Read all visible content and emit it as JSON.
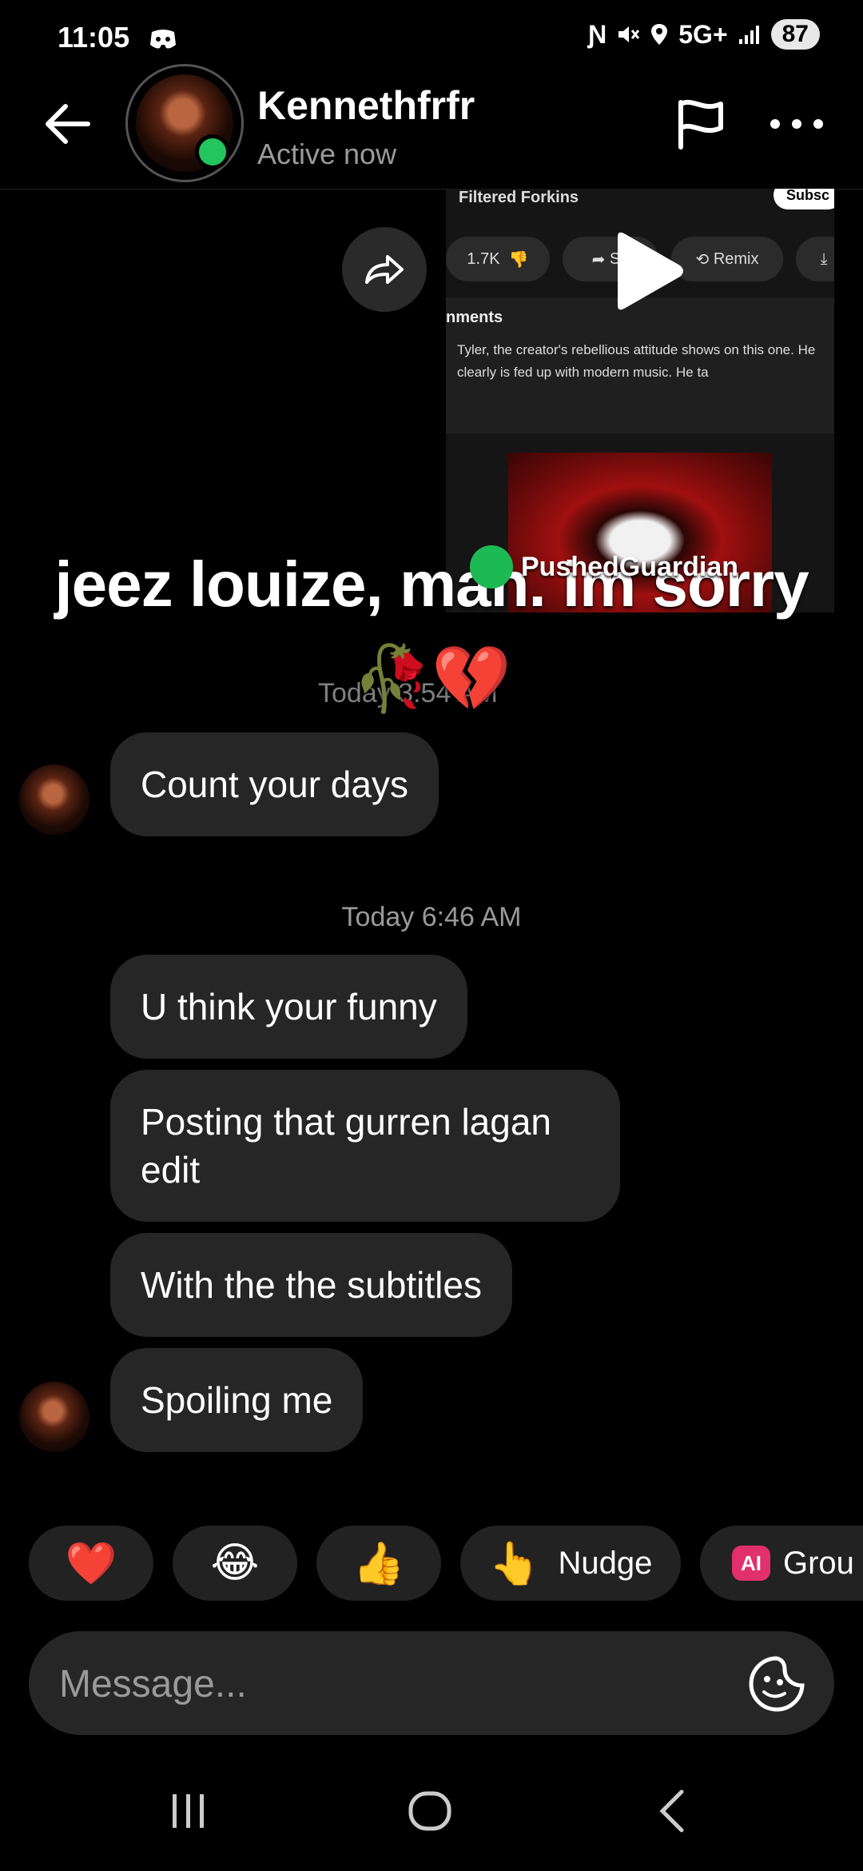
{
  "status_bar": {
    "time": "11:05",
    "network": "5G+",
    "battery": "87"
  },
  "header": {
    "name": "Kennethfrfr",
    "status": "Active now"
  },
  "shared_post": {
    "title": "Filtered Forkins",
    "subscribe": "Subsc",
    "likes": "1.7K",
    "share_label": "Sh",
    "remix_label": "Remix",
    "comments_label": "nments",
    "comment_text": "Tyler, the creator's rebellious attitude shows on this one. He clearly is fed up with modern music. He ta"
  },
  "overlay": {
    "caption": "jeez louize, man. im sorry🥀💔",
    "audio_user": "PushedGuardian"
  },
  "timestamps": {
    "first": "Today 3:54 AM",
    "second": "Today 6:46 AM"
  },
  "messages": [
    {
      "text": "Count your days"
    },
    {
      "text": "U think your funny"
    },
    {
      "text": "Posting that gurren lagan edit"
    },
    {
      "text": "With the the subtitles"
    },
    {
      "text": "Spoiling me"
    }
  ],
  "quick_replies": [
    {
      "icon": "heart-emoji",
      "emoji": "❤️"
    },
    {
      "icon": "laughing-emoji",
      "emoji": "😂"
    },
    {
      "icon": "thumbs-up-emoji",
      "emoji": "👍"
    },
    {
      "icon": "pointing-hand-emoji",
      "emoji": "👆",
      "label": "Nudge"
    },
    {
      "icon": "ai-badge",
      "badge": "AI",
      "label": "Grou"
    }
  ],
  "composer": {
    "placeholder": "Message..."
  },
  "colors": {
    "bubble": "#262626",
    "online": "#22c55e",
    "ai_badge": "#e1306c"
  }
}
